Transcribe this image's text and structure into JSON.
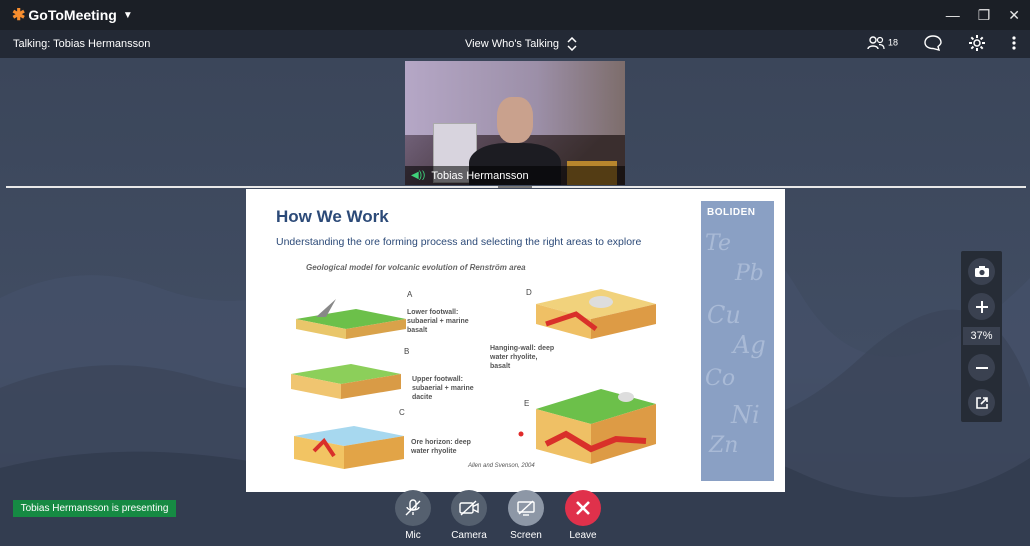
{
  "app": {
    "name": "GoToMeeting"
  },
  "toolbar": {
    "talking": "Talking: Tobias Hermansson",
    "view_mode": "View Who's Talking",
    "participant_count": "18"
  },
  "video": {
    "name": "Tobias Hermansson"
  },
  "slide": {
    "title": "How We Work",
    "subtitle": "Understanding the ore forming process and selecting the right areas to explore",
    "caption": "Geological model for volcanic evolution of Renström area",
    "brand": "BOLIDEN",
    "labels": {
      "a": "A",
      "b": "B",
      "c": "C",
      "d": "D",
      "e": "E",
      "lower": "Lower footwall: subaerial + marine basalt",
      "upper": "Upper footwall: subaerial + marine dacite",
      "ore": "Ore horizon: deep water rhyolite",
      "hanging": "Hanging-wall: deep water rhyolite, basalt"
    },
    "citation": "Allen and Svenson, 2004",
    "elements": [
      "Te",
      "Pb",
      "Cu",
      "Ag",
      "Co",
      "Ni",
      "Zn"
    ]
  },
  "zoom": {
    "level": "37%"
  },
  "presenter_badge": "Tobias Hermansson is presenting",
  "controls": [
    {
      "label": "Mic"
    },
    {
      "label": "Camera"
    },
    {
      "label": "Screen"
    },
    {
      "label": "Leave"
    }
  ],
  "colors": {
    "brand_orange": "#f68d2e",
    "leave_red": "#e0314b",
    "presenting_green": "#168a43",
    "slide_panel": "#8aa0c4"
  }
}
